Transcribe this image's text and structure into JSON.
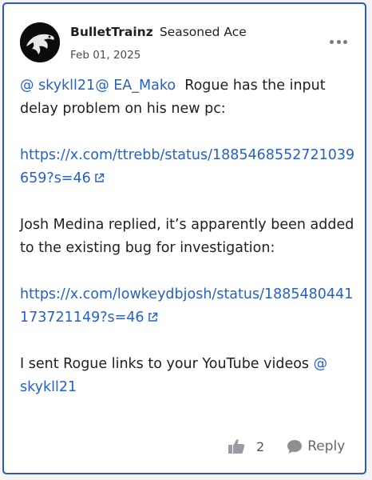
{
  "post": {
    "author": "BulletTrainz",
    "rank": "Seasoned Ace",
    "date": "Feb 01, 2025",
    "mention_1": "@ skykll21",
    "mention_2": "@ EA_Mako",
    "line1_text": "Rogue has the input delay problem on his new pc:",
    "link_1": "https://x.com/ttrebb/status/1885468552721039659?s=46",
    "line2_text": "Josh Medina replied, it’s apparently been added to the existing bug for investigation:",
    "link_2": "https://x.com/lowkeydbjosh/status/1885480441173721149?s=46",
    "line3_text": "I sent Rogue links to your YouTube videos",
    "mention_3": "@ skykll21"
  },
  "actions": {
    "like_count": "2",
    "reply_label": "Reply"
  },
  "icons": {
    "more": "more-options-icon",
    "like": "thumbs-up-icon",
    "reply": "speech-bubble-icon",
    "external": "external-link-icon"
  },
  "colors": {
    "border": "#3259b8",
    "link": "#2660c9",
    "text": "#1e1e24"
  }
}
